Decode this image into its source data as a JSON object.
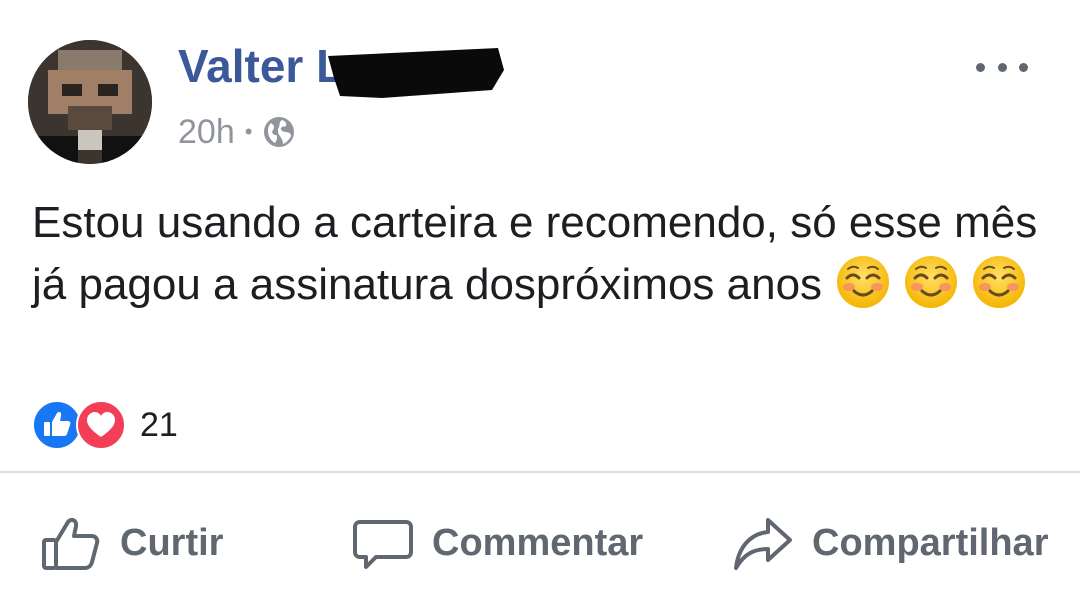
{
  "post": {
    "author": {
      "name": "Valter L"
    },
    "meta": {
      "time": "20h",
      "separator": "•",
      "privacy_icon": "globe-icon"
    },
    "text": "Estou usando a carteira e recomendo, só esse mês já pagou a assinatura dospróximos anos",
    "emojis": [
      "smiling-face-icon",
      "smiling-face-icon",
      "smiling-face-icon"
    ],
    "reactions": {
      "icons": [
        "like-reaction-icon",
        "love-reaction-icon"
      ],
      "count": "21"
    },
    "actions": {
      "like": {
        "label": "Curtir",
        "icon": "thumbs-up-icon"
      },
      "comment": {
        "label": "Commentar",
        "icon": "comment-bubble-icon"
      },
      "share": {
        "label": "Compartilhar",
        "icon": "share-arrow-icon"
      }
    }
  },
  "colors": {
    "author_name": "#3b5998",
    "meta_text": "#90949c",
    "action_text": "#606770",
    "like_blue": "#1877f2",
    "love_red": "#f33e58",
    "divider": "#dadde1"
  }
}
